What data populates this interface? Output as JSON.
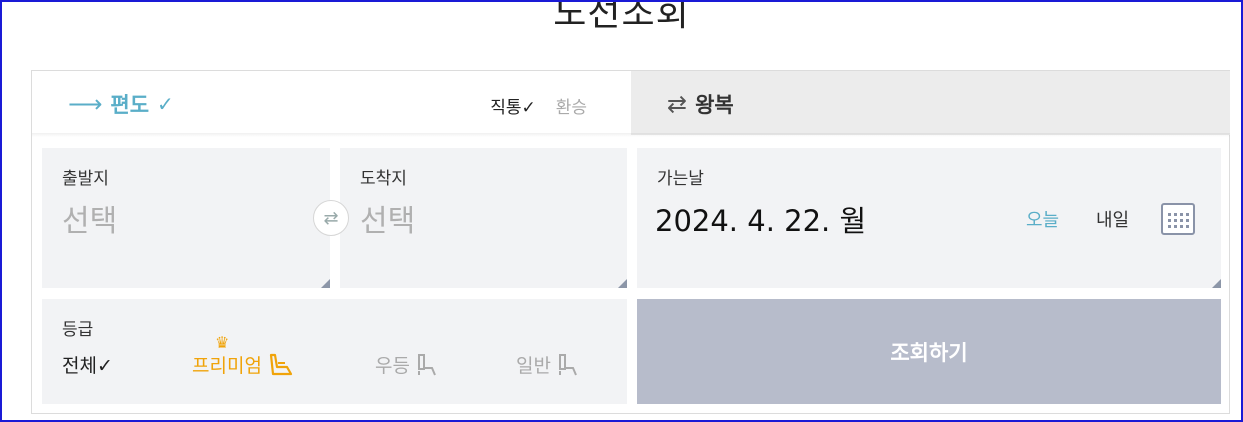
{
  "page": {
    "title": "노선조회"
  },
  "trip_tabs": {
    "oneway": {
      "label": "편도",
      "check": "✓",
      "arrow": "⟶"
    },
    "roundtrip": {
      "label": "왕복",
      "arrow": "⇄"
    },
    "route_types": {
      "direct": "직통✓",
      "transfer": "환승"
    }
  },
  "departure": {
    "label": "출발지",
    "value": "선택"
  },
  "arrival": {
    "label": "도착지",
    "value": "선택"
  },
  "swap": {
    "glyph": "⇄"
  },
  "date": {
    "label": "가는날",
    "value": "2024. 4. 22. 월",
    "today": "오늘",
    "tomorrow": "내일"
  },
  "grade": {
    "label": "등급",
    "options": {
      "all": "전체✓",
      "premium": "프리미엄",
      "first": "우등",
      "standard": "일반"
    },
    "crown": "♛"
  },
  "search": {
    "label": "조회하기"
  },
  "colors": {
    "accent": "#5aaec8",
    "premium": "#f0a30a",
    "search_bg": "#b7bccb",
    "box_bg": "#f2f3f5",
    "frame": "#1a1ad6"
  }
}
